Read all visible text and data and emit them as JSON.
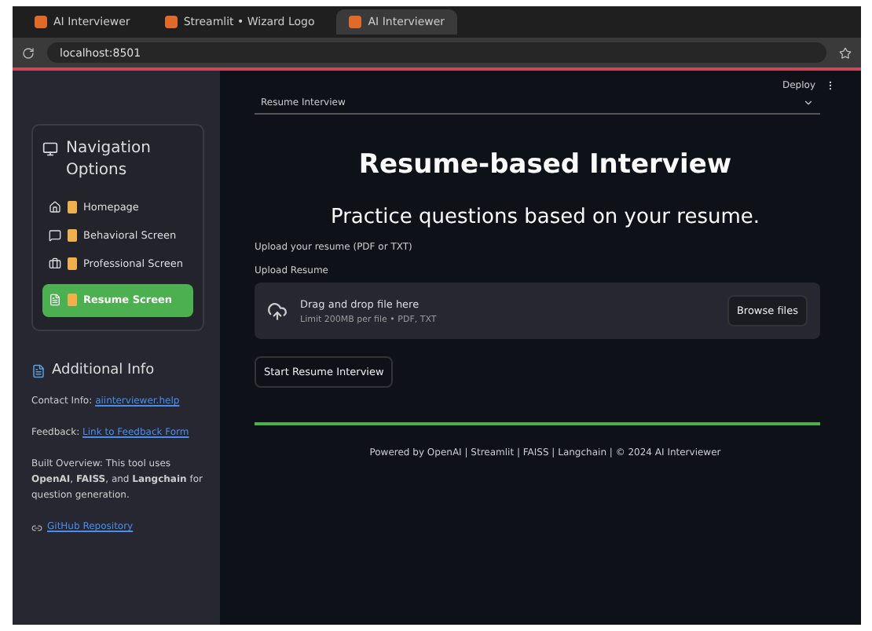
{
  "browser": {
    "tabs": [
      {
        "title": "AI Interviewer",
        "selected": false
      },
      {
        "title": "Streamlit • Wizard Logo",
        "selected": false
      },
      {
        "title": "AI Interviewer",
        "selected": true
      }
    ],
    "url": "localhost:8501"
  },
  "header": {
    "select_value": "Resume Interview",
    "deploy": "Deploy"
  },
  "sidebar": {
    "title": "Navigation Options",
    "items": [
      {
        "label": "Homepage",
        "selected": false
      },
      {
        "label": "Behavioral Screen",
        "selected": false
      },
      {
        "label": "Professional Screen",
        "selected": false
      },
      {
        "label": "Resume Screen",
        "selected": true
      }
    ],
    "info_title": "Additional Info",
    "contact": {
      "label": "Contact Info:",
      "link": "aiinterviewer.help"
    },
    "feedback": {
      "label": "Feedback:",
      "link": "Link to Feedback Form"
    },
    "overview": "Built Overview: This tool uses **OpenAI**, **FAISS**, and **Langchain** for question generation.",
    "repo_link": "GitHub Repository"
  },
  "main": {
    "title": "Resume-based Interview",
    "subtitle": "Practice questions based on your resume.",
    "intro": "Upload your resume (PDF or TXT)",
    "uploader_label": "Upload Resume",
    "drop_text": "Drag and drop file here",
    "limit_text": "Limit 200MB per file • PDF, TXT",
    "browse": "Browse files",
    "start": "Start Resume Interview",
    "footer": "Powered by OpenAI | Streamlit | FAISS | Langchain | © 2024 AI Interviewer"
  }
}
